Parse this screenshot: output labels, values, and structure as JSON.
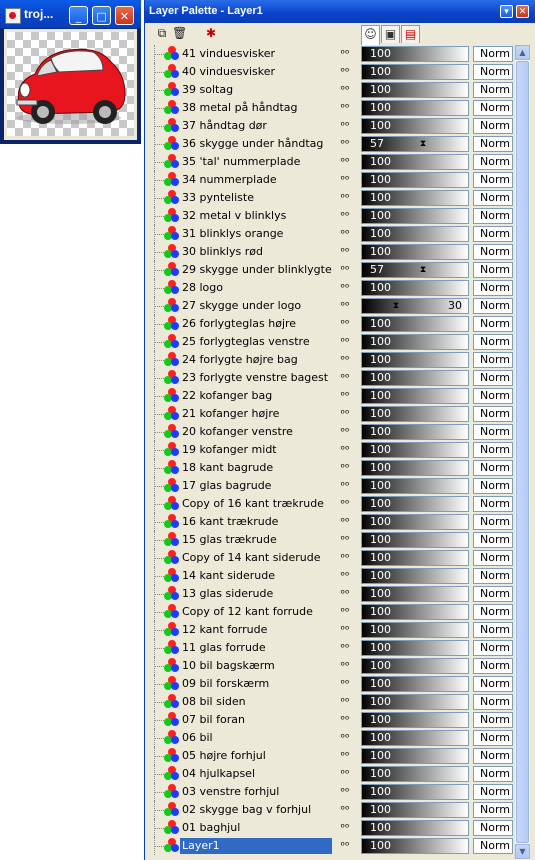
{
  "thumbnail_window": {
    "title": "troj...",
    "buttons": {
      "minimize": "_",
      "maximize": "□",
      "close": "✕"
    }
  },
  "palette": {
    "title": "Layer Palette - Layer1",
    "buttons": {
      "options": "▾",
      "close": "✕"
    },
    "tool_icons": [
      "new-layer-icon",
      "delete-layer-icon",
      "new-mask-icon"
    ],
    "tab_icons": [
      "layers-tab-icon",
      "mask-tab-icon",
      "channels-tab-icon"
    ],
    "eye_glyph": "ᵒᵒ",
    "layers": [
      {
        "name": "41 vinduesvisker",
        "opacity": 100,
        "blend": "Norm"
      },
      {
        "name": "40 vinduesvisker",
        "opacity": 100,
        "blend": "Norm"
      },
      {
        "name": "39 soltag",
        "opacity": 100,
        "blend": "Norm"
      },
      {
        "name": "38 metal på håndtag",
        "opacity": 100,
        "blend": "Norm"
      },
      {
        "name": "37 håndtag dør",
        "opacity": 100,
        "blend": "Norm"
      },
      {
        "name": "36 skygge under håndtag",
        "opacity": 57,
        "blend": "Norm"
      },
      {
        "name": "35 'tal' nummerplade",
        "opacity": 100,
        "blend": "Norm"
      },
      {
        "name": "34 nummerplade",
        "opacity": 100,
        "blend": "Norm"
      },
      {
        "name": "33 pynteliste",
        "opacity": 100,
        "blend": "Norm"
      },
      {
        "name": "32 metal v blinklys",
        "opacity": 100,
        "blend": "Norm"
      },
      {
        "name": "31 blinklys orange",
        "opacity": 100,
        "blend": "Norm"
      },
      {
        "name": "30 blinklys rød",
        "opacity": 100,
        "blend": "Norm"
      },
      {
        "name": "29 skygge under blinklygte",
        "opacity": 57,
        "blend": "Norm"
      },
      {
        "name": "28 logo",
        "opacity": 100,
        "blend": "Norm"
      },
      {
        "name": "27 skygge under logo",
        "opacity": 30,
        "blend": "Norm"
      },
      {
        "name": "26 forlygteglas højre",
        "opacity": 100,
        "blend": "Norm"
      },
      {
        "name": "25 forlygteglas venstre",
        "opacity": 100,
        "blend": "Norm"
      },
      {
        "name": "24 forlygte højre bag",
        "opacity": 100,
        "blend": "Norm"
      },
      {
        "name": "23 forlygte venstre bagest",
        "opacity": 100,
        "blend": "Norm"
      },
      {
        "name": "22 kofanger bag",
        "opacity": 100,
        "blend": "Norm"
      },
      {
        "name": "21 kofanger højre",
        "opacity": 100,
        "blend": "Norm"
      },
      {
        "name": "20 kofanger venstre",
        "opacity": 100,
        "blend": "Norm"
      },
      {
        "name": "19 kofanger midt",
        "opacity": 100,
        "blend": "Norm"
      },
      {
        "name": "18 kant bagrude",
        "opacity": 100,
        "blend": "Norm"
      },
      {
        "name": "17 glas bagrude",
        "opacity": 100,
        "blend": "Norm"
      },
      {
        "name": "Copy of 16 kant trækrude",
        "opacity": 100,
        "blend": "Norm"
      },
      {
        "name": "16 kant trækrude",
        "opacity": 100,
        "blend": "Norm"
      },
      {
        "name": "15 glas trækrude",
        "opacity": 100,
        "blend": "Norm"
      },
      {
        "name": "Copy of 14 kant siderude",
        "opacity": 100,
        "blend": "Norm"
      },
      {
        "name": "14 kant siderude",
        "opacity": 100,
        "blend": "Norm"
      },
      {
        "name": "13 glas siderude",
        "opacity": 100,
        "blend": "Norm"
      },
      {
        "name": "Copy of 12 kant forrude",
        "opacity": 100,
        "blend": "Norm"
      },
      {
        "name": "12 kant forrude",
        "opacity": 100,
        "blend": "Norm"
      },
      {
        "name": "11 glas forrude",
        "opacity": 100,
        "blend": "Norm"
      },
      {
        "name": "10 bil bagskærm",
        "opacity": 100,
        "blend": "Norm"
      },
      {
        "name": "09 bil forskærm",
        "opacity": 100,
        "blend": "Norm"
      },
      {
        "name": "08 bil siden",
        "opacity": 100,
        "blend": "Norm"
      },
      {
        "name": "07 bil foran",
        "opacity": 100,
        "blend": "Norm"
      },
      {
        "name": "06 bil",
        "opacity": 100,
        "blend": "Norm"
      },
      {
        "name": "05 højre forhjul",
        "opacity": 100,
        "blend": "Norm"
      },
      {
        "name": "04 hjulkapsel",
        "opacity": 100,
        "blend": "Norm"
      },
      {
        "name": "03 venstre forhjul",
        "opacity": 100,
        "blend": "Norm"
      },
      {
        "name": "02 skygge bag v forhjul",
        "opacity": 100,
        "blend": "Norm"
      },
      {
        "name": "01 baghjul",
        "opacity": 100,
        "blend": "Norm"
      },
      {
        "name": "Layer1",
        "opacity": 100,
        "blend": "Norm",
        "selected": true
      }
    ]
  },
  "colors": {
    "selection": "#316ac5",
    "titlebar": "#0843c9",
    "car_body": "#e8141e"
  }
}
